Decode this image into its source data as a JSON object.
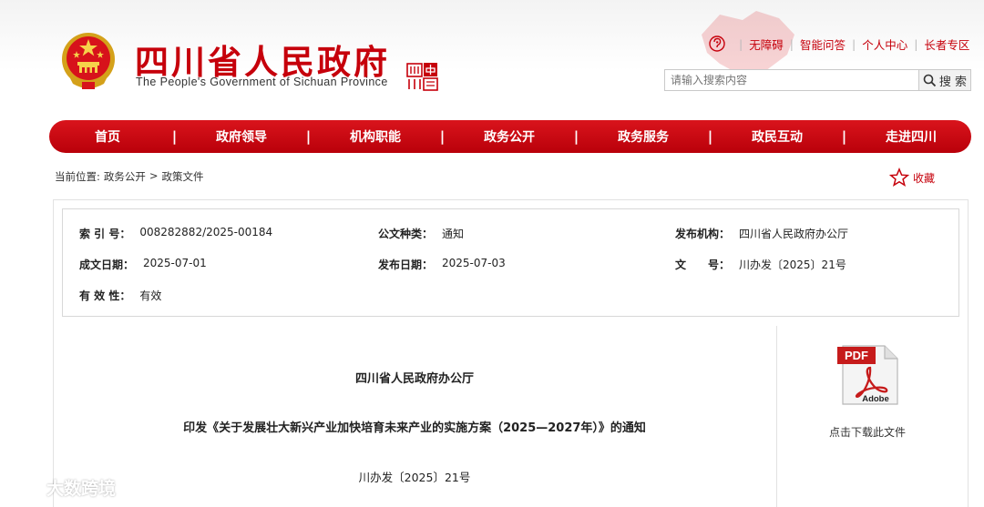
{
  "header": {
    "site_title": "四川省人民政府",
    "site_subtitle": "The People's Government of Sichuan Province",
    "seal_text": "四川·中国",
    "top_links": [
      "无障碍",
      "智能问答",
      "个人中心",
      "长者专区"
    ],
    "search_placeholder": "请输入搜索内容",
    "search_button": "搜 索"
  },
  "nav": {
    "items": [
      "首页",
      "政府领导",
      "机构职能",
      "政务公开",
      "政务服务",
      "政民互动",
      "走进四川"
    ]
  },
  "breadcrumb": {
    "prefix": "当前位置:",
    "items": [
      "政务公开",
      "政策文件"
    ],
    "separator": ">"
  },
  "favorite": {
    "label": "收藏"
  },
  "meta": {
    "index_label": "索 引 号：",
    "index_value": "008282882/2025-00184",
    "type_label": "公文种类：",
    "type_value": "通知",
    "publisher_label": "发布机构：",
    "publisher_value": "四川省人民政府办公厅",
    "created_label": "成文日期：",
    "created_value": "2025-07-01",
    "published_label": "发布日期：",
    "published_value": "2025-07-03",
    "docno_label": "文　　号：",
    "docno_value": "川办发〔2025〕21号",
    "validity_label": "有 效 性：",
    "validity_value": "有效"
  },
  "document": {
    "issuer": "四川省人民政府办公厅",
    "title": "印发《关于发展壮大新兴产业加快培育未来产业的实施方案（2025—2027年）》的通知",
    "number": "川办发〔2025〕21号"
  },
  "sidebar": {
    "pdf_label": "PDF",
    "adobe_label": "Adobe",
    "download_label": "点击下载此文件"
  },
  "watermark": {
    "text": "大数跨境"
  },
  "colors": {
    "brand_red": "#c6000b",
    "nav_red": "#d9141c"
  },
  "icons": [
    "national-emblem-icon",
    "ear-icon",
    "search-icon",
    "star-icon",
    "pdf-file-icon"
  ]
}
